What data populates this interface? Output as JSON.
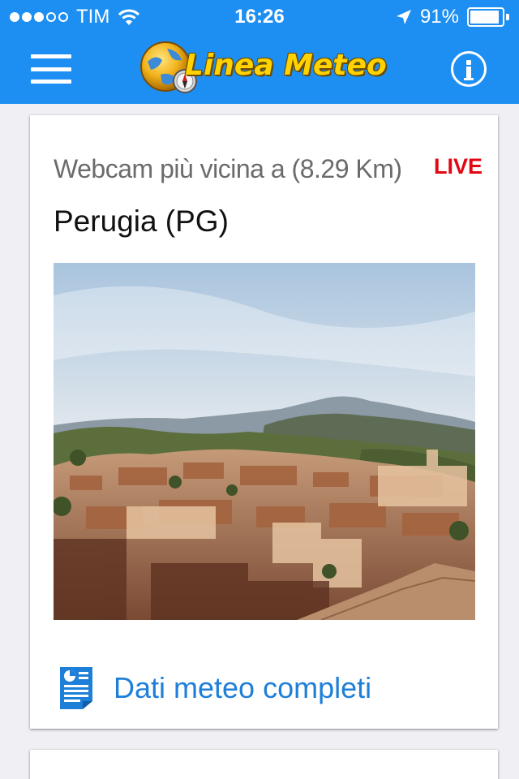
{
  "status_bar": {
    "carrier": "TIM",
    "time": "16:26",
    "battery_percent": "91%",
    "battery_level": 0.91,
    "signal_bars_filled": 3,
    "signal_bars_total": 5
  },
  "header": {
    "logo_text": "Linea Meteo",
    "background_color": "#1e8ff2",
    "logo_text_color": "#ffd200",
    "icons": [
      "menu-icon",
      "globe-compass-logo",
      "info-icon"
    ]
  },
  "webcam_card": {
    "nearest_label": "Webcam più vicina a (8.29 Km)",
    "live_label": "LIVE",
    "live_color": "#e30613",
    "location": "Perugia (PG)",
    "image_subject": "webcam-photo",
    "data_link_label": "Dati meteo completi",
    "data_link_icon": "document-chart-icon",
    "link_color": "#1e7fd8"
  }
}
